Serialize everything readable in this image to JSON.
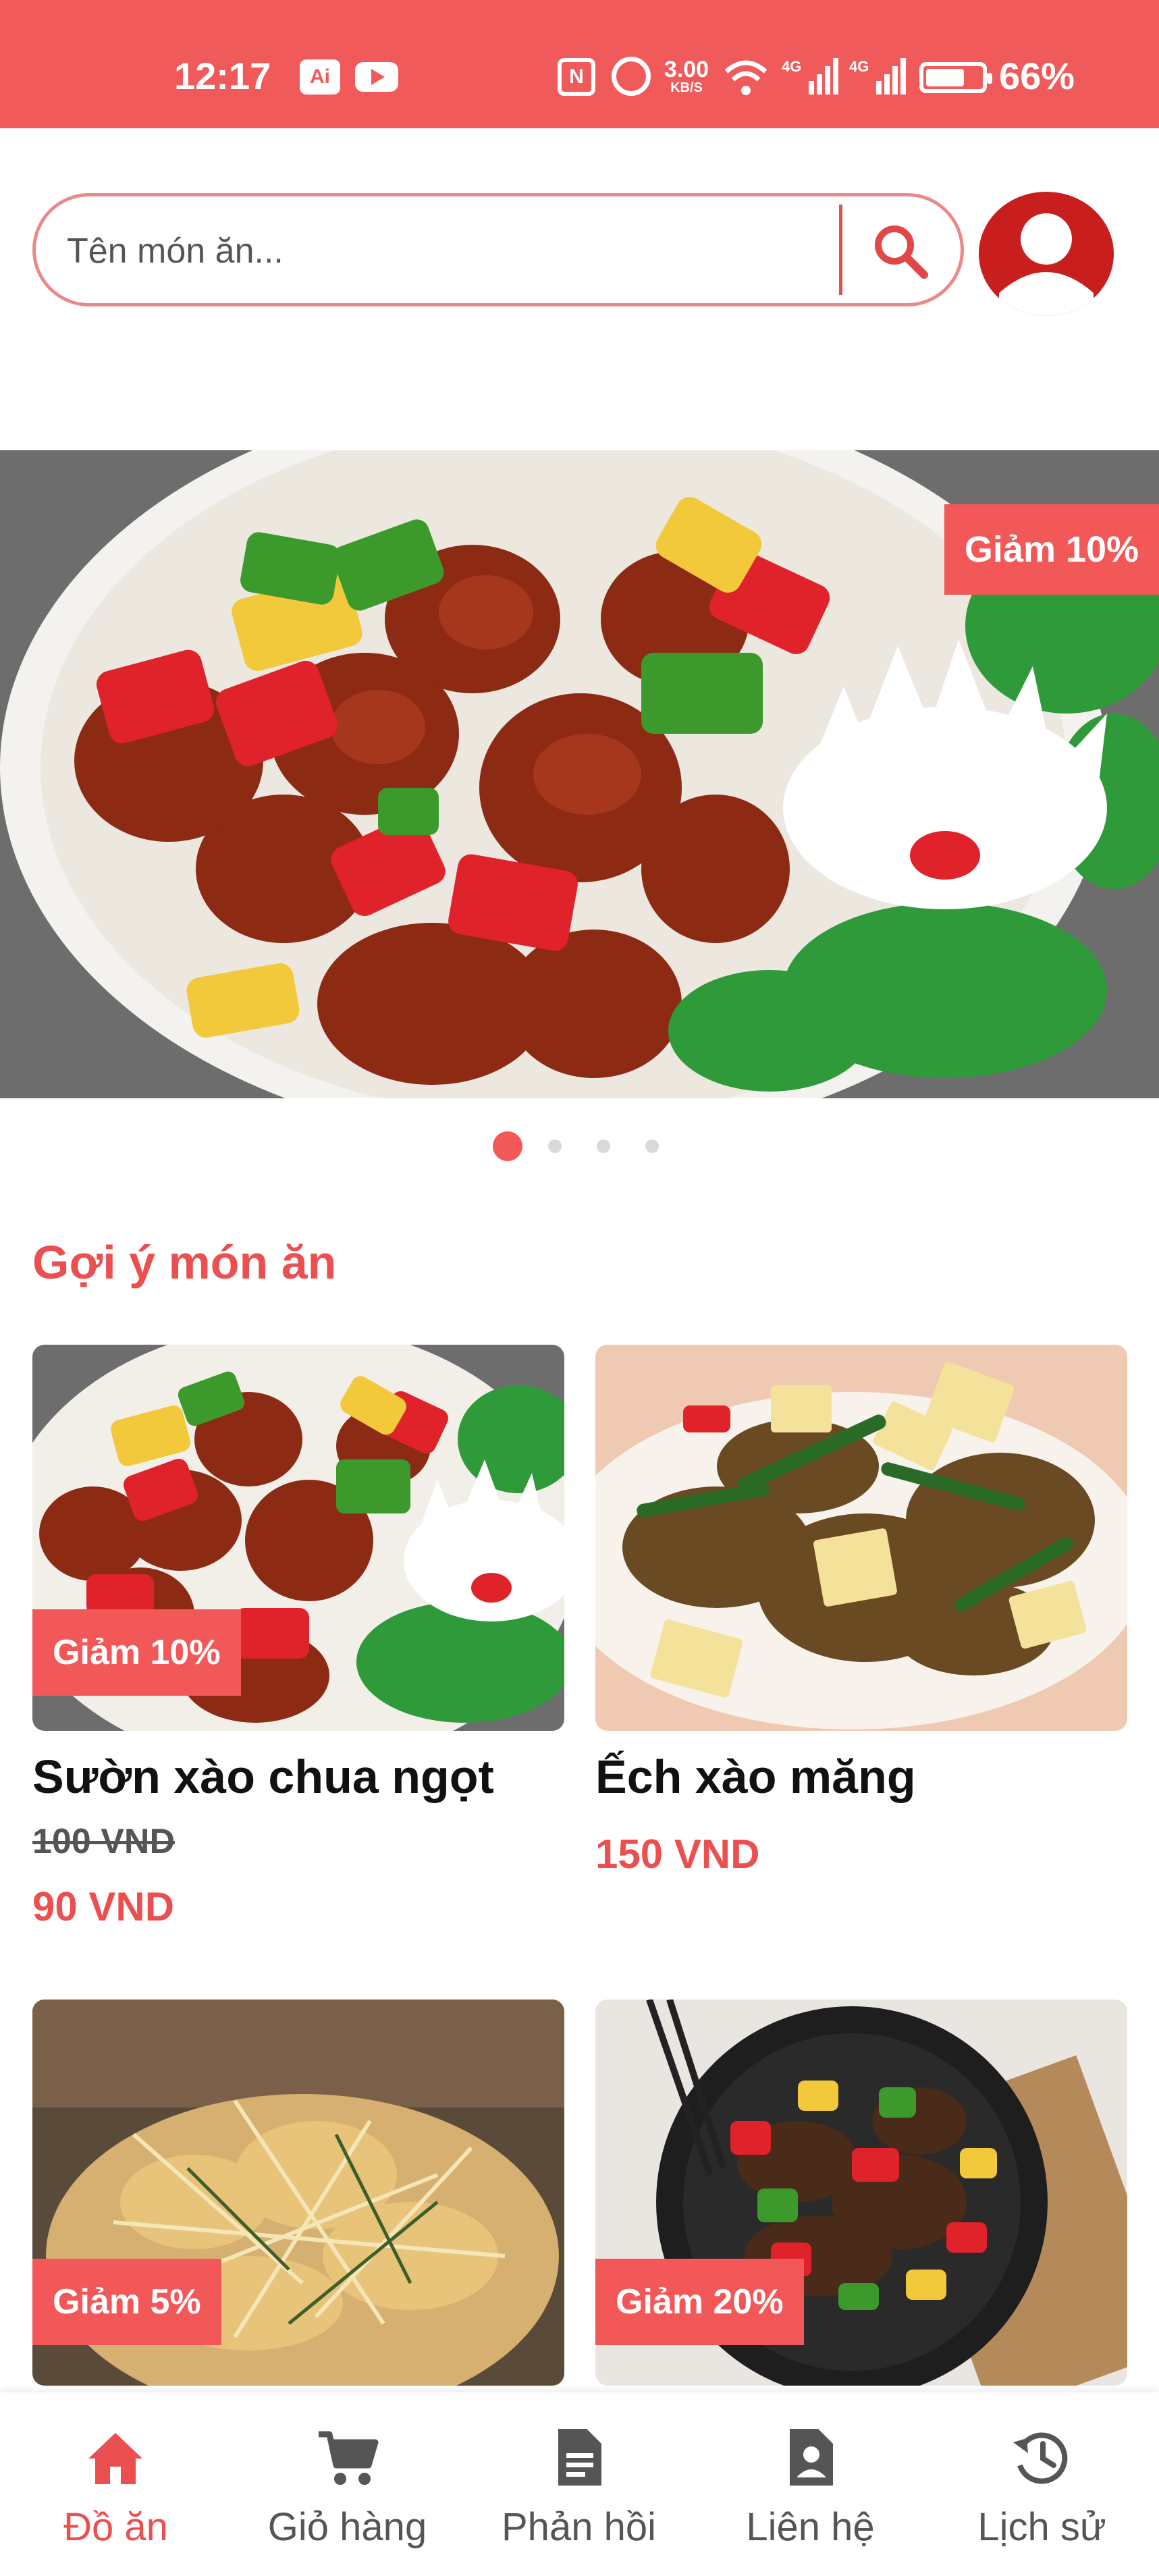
{
  "status_bar": {
    "time": "12:17",
    "ai_label": "Ai",
    "net_speed_value": "3.00",
    "net_speed_unit": "KB/S",
    "battery": "66%",
    "signal_labels": [
      "4G",
      "4G"
    ]
  },
  "search": {
    "placeholder": "Tên món ăn..."
  },
  "banner": {
    "badge": "Giảm 10%",
    "slides": 4,
    "active_slide": 1
  },
  "section": {
    "title": "Gợi ý món ăn"
  },
  "dishes": [
    {
      "name": "Sườn xào chua ngọt",
      "badge": "Giảm 10%",
      "old_price": "100 VND",
      "price": "90 VND"
    },
    {
      "name": "Ếch xào măng",
      "badge": "",
      "old_price": "",
      "price": "150 VND"
    },
    {
      "name": "",
      "badge": "Giảm 5%",
      "old_price": "",
      "price": ""
    },
    {
      "name": "",
      "badge": "Giảm 20%",
      "old_price": "",
      "price": ""
    }
  ],
  "nav": {
    "items": [
      {
        "label": "Đồ ăn",
        "icon": "home-icon",
        "active": true
      },
      {
        "label": "Giỏ hàng",
        "icon": "cart-icon",
        "active": false
      },
      {
        "label": "Phản hồi",
        "icon": "document-icon",
        "active": false
      },
      {
        "label": "Liên hệ",
        "icon": "contact-icon",
        "active": false
      },
      {
        "label": "Lịch sử",
        "icon": "history-icon",
        "active": false
      }
    ]
  },
  "colors": {
    "accent": "#f25858",
    "status_bar": "#f05a5a",
    "avatar": "#c81e1e"
  }
}
